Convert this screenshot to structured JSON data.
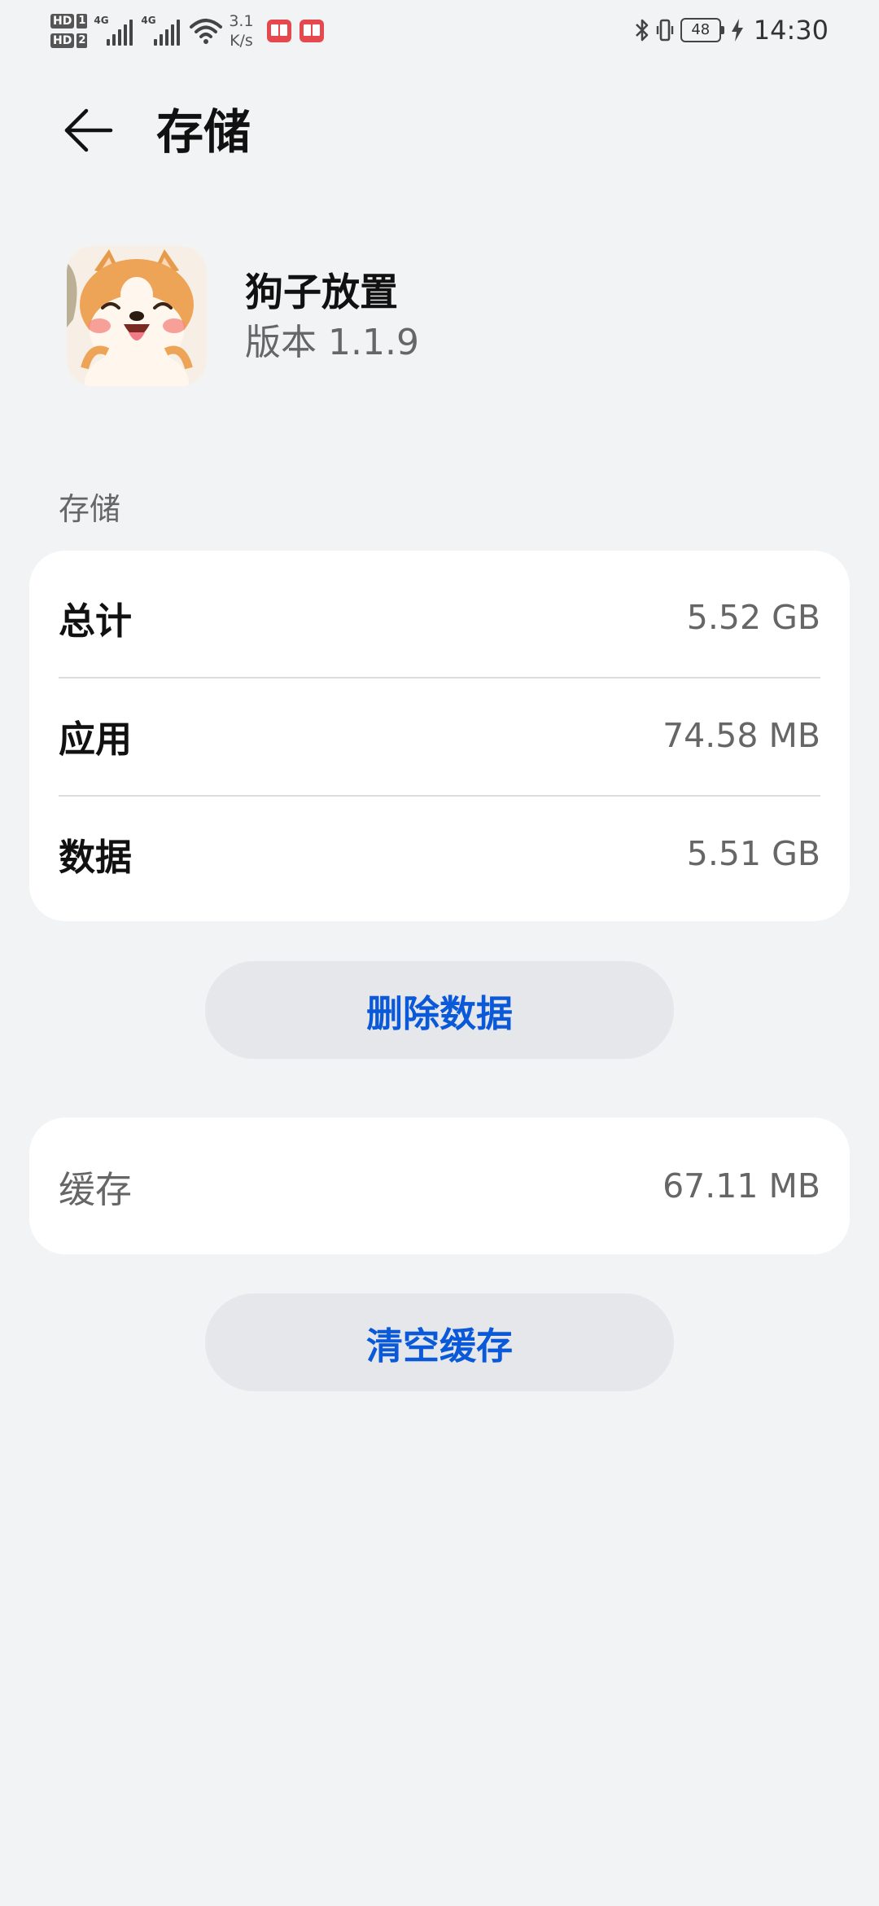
{
  "status_bar": {
    "sim1": "HD",
    "sim1_slot": "1",
    "sim2": "HD",
    "sim2_slot": "2",
    "net1": "4G",
    "net2": "4G",
    "speed_value": "3.1",
    "speed_unit": "K/s",
    "battery": "48",
    "time": "14:30",
    "notification_icons": [
      "book-app-icon",
      "book-app-icon"
    ]
  },
  "header": {
    "title": "存储",
    "back_icon": "arrow-left-icon"
  },
  "app": {
    "name": "狗子放置",
    "version": "版本 1.1.9",
    "icon": "shiba-dog-icon"
  },
  "storage_section": {
    "label": "存储",
    "rows": [
      {
        "label": "总计",
        "value": "5.52 GB"
      },
      {
        "label": "应用",
        "value": "74.58 MB"
      },
      {
        "label": "数据",
        "value": "5.51 GB"
      }
    ],
    "delete_button": "删除数据"
  },
  "cache_section": {
    "label": "缓存",
    "value": "67.11 MB",
    "clear_button": "清空缓存"
  },
  "colors": {
    "background": "#f1f3f5",
    "card": "#ffffff",
    "button_bg": "#e5e7ea",
    "accent": "#0a59d8"
  }
}
